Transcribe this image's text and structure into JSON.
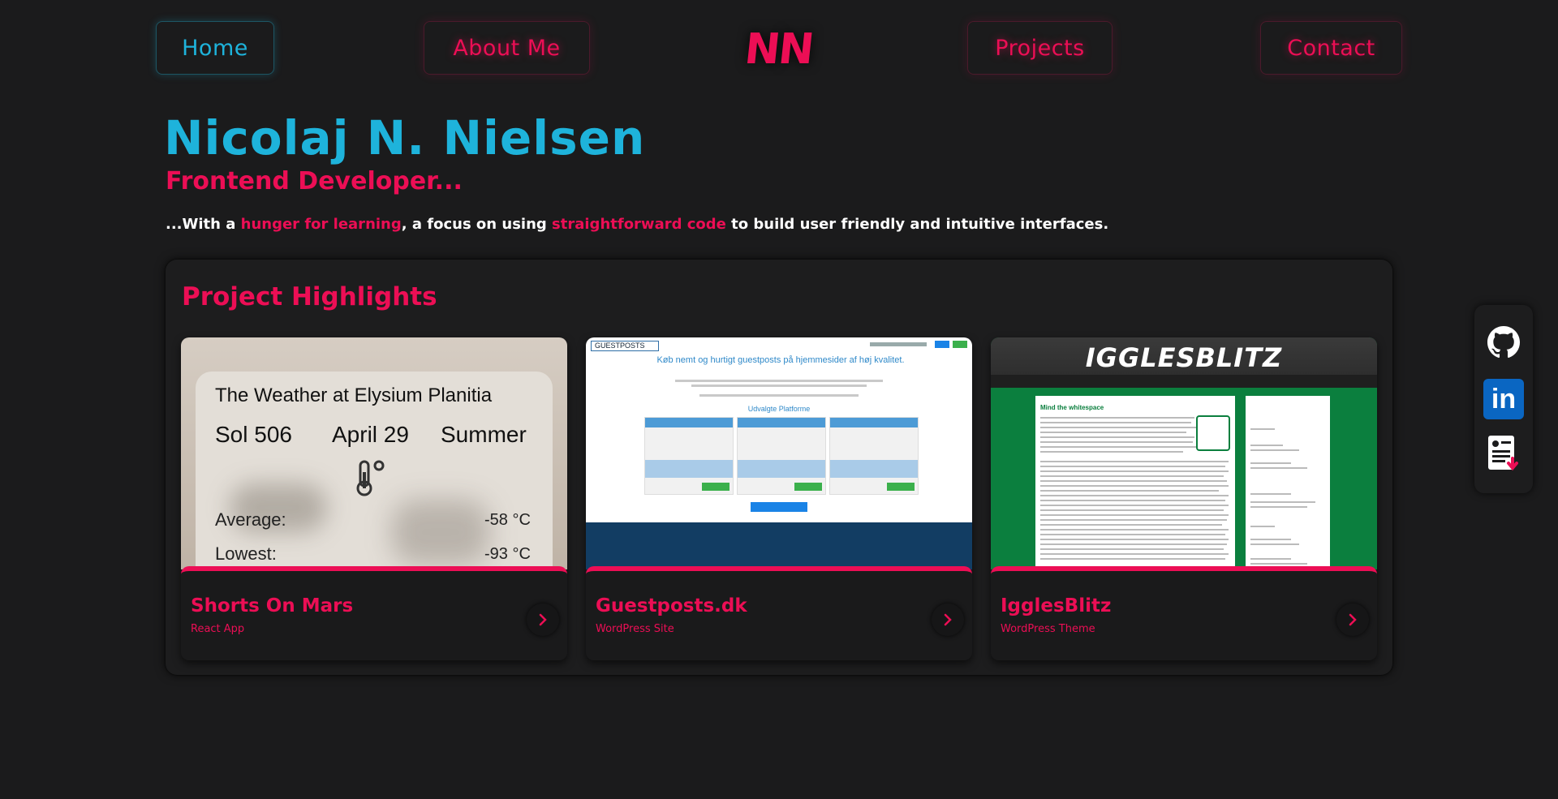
{
  "nav": {
    "home": "Home",
    "about": "About Me",
    "logo": "NN",
    "projects": "Projects",
    "contact": "Contact"
  },
  "hero": {
    "name": "Nicolaj N. Nielsen",
    "role": "Frontend Developer...",
    "tagline": {
      "part1": "...With a ",
      "hl1": "hunger for learning",
      "part2": ", a focus on using ",
      "hl2": "straightforward code",
      "part3": " to build user friendly and intuitive interfaces."
    }
  },
  "highlights": {
    "title": "Project Highlights",
    "cards": [
      {
        "title": "Shorts On Mars",
        "subtitle": "React App",
        "thumb": {
          "heading": "The Weather at Elysium Planitia",
          "sol": "Sol 506",
          "date": "April 29",
          "season": "Summer",
          "avg_label": "Average:",
          "avg_value": "-58 °C",
          "low_label": "Lowest:",
          "low_value": "-93 °C"
        }
      },
      {
        "title": "Guestposts.dk",
        "subtitle": "WordPress Site",
        "thumb": {
          "logo": "GUESTPOSTS",
          "heading": "Køb nemt og hurtigt guestposts på hjemmesider af høj kvalitet.",
          "subheading": "Udvalgte Platforme"
        }
      },
      {
        "title": "IgglesBlitz",
        "subtitle": "WordPress Theme",
        "thumb": {
          "banner": "IGGLESBLITZ",
          "post_title": "Mind the whitespace"
        }
      }
    ]
  },
  "social": {
    "icons": [
      "github-icon",
      "linkedin-icon",
      "cv-download-icon"
    ]
  },
  "colors": {
    "accent_blue": "#1eb3db",
    "accent_pink": "#ec0e55",
    "background": "#1b1b1c"
  }
}
